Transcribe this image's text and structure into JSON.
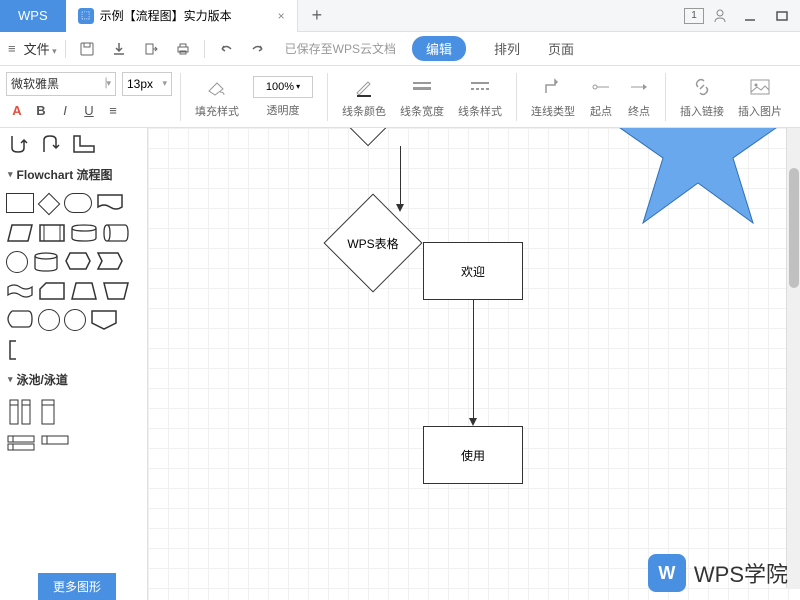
{
  "app_name": "WPS",
  "tab": {
    "title": "示例【流程图】实力版本",
    "icon": "flowchart"
  },
  "titlebar_right": {
    "page_indicator": "1"
  },
  "menubar": {
    "file": "文件",
    "save_status": "已保存至WPS云文档",
    "pill": "编辑",
    "items": [
      "排列",
      "页面"
    ]
  },
  "toolbar": {
    "font": "微软雅黑",
    "size": "13px",
    "zoom": "100%",
    "groups": {
      "fill": "填充样式",
      "opacity": "透明度",
      "line_color": "线条颜色",
      "line_width": "线条宽度",
      "line_style": "线条样式",
      "conn_type": "连线类型",
      "start": "起点",
      "end": "终点",
      "link": "插入链接",
      "image": "插入图片"
    }
  },
  "sidebar": {
    "section_flowchart": "Flowchart 流程图",
    "section_swimlane": "泳池/泳道",
    "more_shapes": "更多图形"
  },
  "canvas": {
    "diamond_label": "WPS表格",
    "box1": "欢迎",
    "box2": "使用"
  },
  "watermark": {
    "logo": "W",
    "text": "WPS学院"
  }
}
